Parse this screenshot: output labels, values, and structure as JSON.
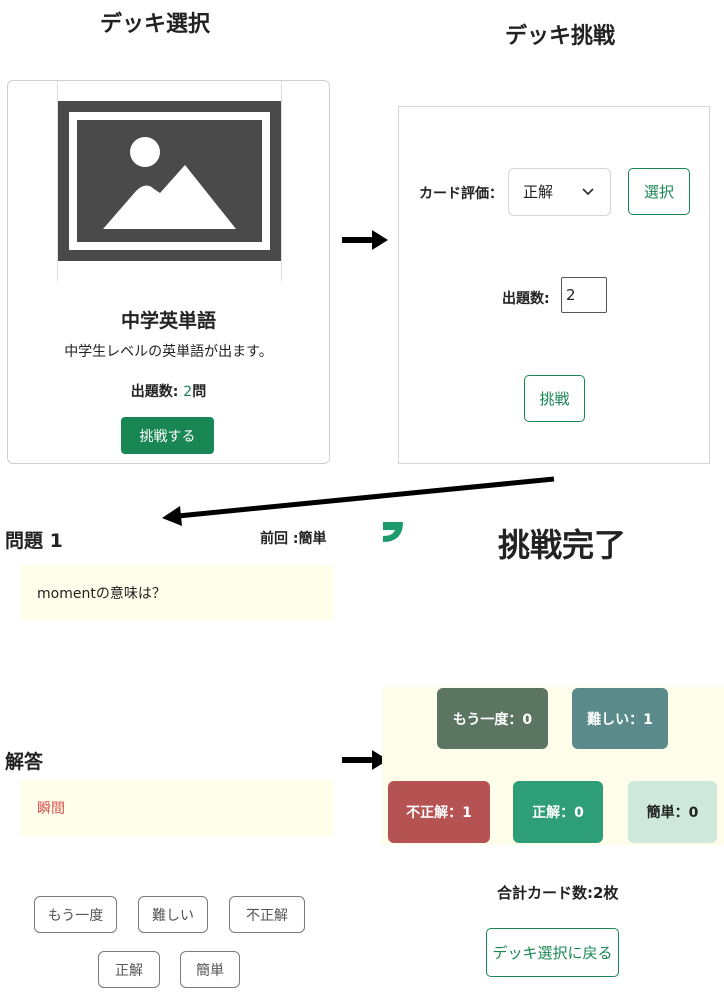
{
  "deck_select": {
    "title": "デッキ選択",
    "deck": {
      "name": "中学英単語",
      "description": "中学生レベルの英単語が出ます。",
      "count_label": "出題数: ",
      "count_value": "2",
      "count_unit": "問",
      "challenge_button": "挑戦する"
    }
  },
  "deck_challenge": {
    "title": "デッキ挑戦",
    "rating_label": "カード評価：",
    "rating_selected": "正解",
    "select_button": "選択",
    "count_label": "出題数:",
    "count_value": "2",
    "challenge_button": "挑戦"
  },
  "question": {
    "title": "問題 1",
    "previous": "前回 :簡単",
    "text": "momentの意味は？",
    "answer_title": "解答",
    "answer": "瞬間",
    "buttons": [
      "もう一度",
      "難しい",
      "不正解",
      "正解",
      "簡単"
    ]
  },
  "result": {
    "title": "挑戦完了",
    "stats": [
      {
        "label": "もう一度：0",
        "color": "#5b7562"
      },
      {
        "label": "難しい：1",
        "color": "#5b8a8a"
      },
      {
        "label": "不正解：1",
        "color": "#b55252"
      },
      {
        "label": "正解：0",
        "color": "#2e9e78"
      },
      {
        "label": "簡単：0",
        "color": "#cfe8dc"
      }
    ],
    "total": "合計カード数:2枚",
    "back_button": "デッキ選択に戻る"
  },
  "colors": {
    "accent": "#198754",
    "answer_red": "#d9534f",
    "note_bg": "#fefeea"
  }
}
